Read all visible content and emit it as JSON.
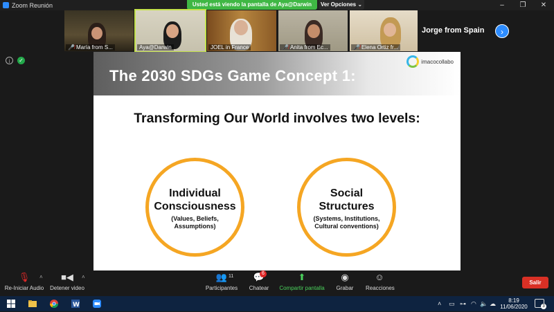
{
  "window": {
    "title": "Zoom Reunión",
    "controls": [
      "–",
      "❐",
      "✕"
    ]
  },
  "share_banner": "Usted está viendo la pantalla de Aya@Darwin",
  "view_options": "Ver Opciones ⌄",
  "participants": [
    {
      "name": "María from S...",
      "muted": true
    },
    {
      "name": "Aya@Darwin",
      "muted": false,
      "active": true
    },
    {
      "name": "JOEL in France",
      "muted": false
    },
    {
      "name": "Anita from Ec...",
      "muted": true
    },
    {
      "name": "Elena Ortiz fr...",
      "muted": true
    }
  ],
  "featured_name": "Jorge from Spain",
  "slide": {
    "title": "The 2030 SDGs Game Concept 1:",
    "logo_text": "imacocollabo",
    "subheading": "Transforming Our World involves two levels:",
    "circles": [
      {
        "line1": "Individual",
        "line2": "Consciousness",
        "detail1": "(Values, Beliefs,",
        "detail2": "Assumptions)"
      },
      {
        "line1": "Social",
        "line2": "Structures",
        "detail1": "(Systems, Institutions,",
        "detail2": "Cultural conventions)"
      }
    ]
  },
  "toolbar": {
    "audio": "Re-Iniciar Audio",
    "video": "Detener video",
    "participants": "Participantes",
    "participants_count": "11",
    "chat": "Chatear",
    "chat_badge": "6",
    "share": "Compartir pantalla",
    "record": "Grabar",
    "reactions": "Reacciones",
    "leave": "Salir"
  },
  "taskbar": {
    "time": "8:19",
    "date": "11/06/2020",
    "notifications": "3"
  },
  "colors": {
    "share_green": "#3fb744",
    "circle_orange": "#f5a623",
    "leave_red": "#d93025",
    "zoom_blue": "#2d8cff"
  }
}
